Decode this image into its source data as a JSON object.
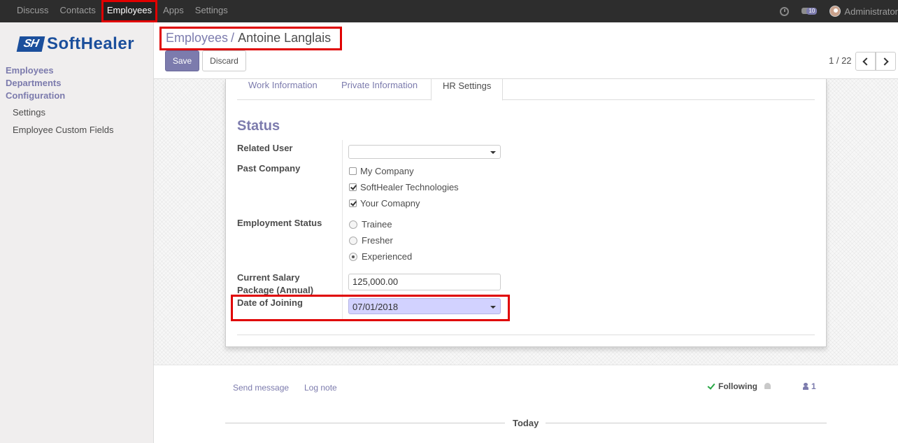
{
  "topbar": {
    "menu": [
      "Discuss",
      "Contacts",
      "Employees",
      "Apps",
      "Settings"
    ],
    "active_menu": "Employees",
    "notification_count": "10",
    "user_name": "Administrator"
  },
  "sidebar": {
    "logo_mark": "SH",
    "logo_text": "SoftHealer",
    "sections": [
      "Employees",
      "Departments",
      "Configuration"
    ],
    "items": [
      "Settings",
      "Employee Custom Fields"
    ]
  },
  "control": {
    "breadcrumb_parent": "Employees",
    "breadcrumb_sep": "/",
    "breadcrumb_current": "Antoine Langlais",
    "save_label": "Save",
    "discard_label": "Discard",
    "pager": "1 / 22"
  },
  "form": {
    "tabs": [
      "Work Information",
      "Private Information",
      "HR Settings"
    ],
    "active_tab": "HR Settings",
    "section_title": "Status",
    "related_user_label": "Related User",
    "related_user_value": "",
    "past_company_label": "Past Company",
    "past_company_options": [
      {
        "label": "My Company",
        "checked": false
      },
      {
        "label": "SoftHealer Technologies",
        "checked": true
      },
      {
        "label": "Your Comapny",
        "checked": true
      }
    ],
    "employment_status_label": "Employment Status",
    "employment_status_options": [
      {
        "label": "Trainee",
        "checked": false
      },
      {
        "label": "Fresher",
        "checked": false
      },
      {
        "label": "Experienced",
        "checked": true
      }
    ],
    "salary_label_line1": "Current Salary",
    "salary_label_line2": "Package (Annual)",
    "salary_value": "125,000.00",
    "joining_label": "Date of Joining",
    "joining_value": "07/01/2018"
  },
  "chatter": {
    "send_message": "Send message",
    "log_note": "Log note",
    "following": "Following",
    "followers_count": "1",
    "today": "Today"
  },
  "colors": {
    "accent": "#7c7bad",
    "highlight_box": "#e00000",
    "topbar": "#2d2d2d"
  }
}
